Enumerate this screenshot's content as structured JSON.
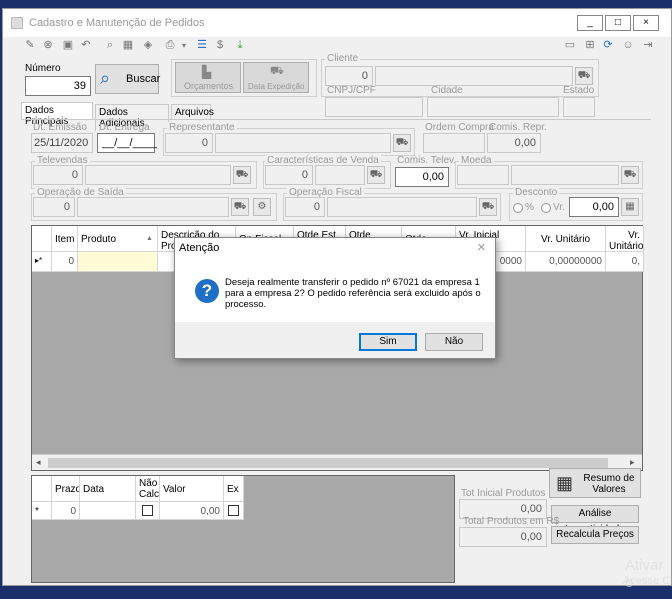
{
  "window": {
    "title": "Cadastro e Manutenção de Pedidos",
    "min": "_",
    "max": "□",
    "close": "×"
  },
  "numero": {
    "label": "Número",
    "value": "39",
    "buscar": "Buscar"
  },
  "tools": {
    "orcamentos": "Orçamentos",
    "data_expedicao": "Data Expedição"
  },
  "cliente": {
    "label": "Cliente",
    "code": "0",
    "cnpj_label": "CNPJ/CPF",
    "cidade_label": "Cidade",
    "estado_label": "Estado"
  },
  "tabs": [
    "Dados Principais",
    "Dados Adicionais",
    "Arquivos"
  ],
  "dados": {
    "dt_emissao_label": "Dt. Emissão",
    "dt_emissao": "25/11/2020",
    "dt_entrega_label": "Dt. Entrega",
    "dt_entrega": "__/__/____",
    "representante_label": "Representante",
    "representante": "0",
    "ordem_compra_label": "Ordem Compra",
    "comis_repr_label": "Comis. Repr.",
    "comis_repr": "0,00",
    "televendas_label": "Televendas",
    "televendas": "0",
    "caracteristicas_label": "Características de Venda",
    "caracteristicas": "0",
    "comis_telev_label": "Comis. Telev.",
    "comis_telev": "0,00",
    "moeda_label": "Moeda",
    "operacao_saida_label": "Operação de Saída",
    "operacao_saida": "0",
    "operacao_fiscal_label": "Operação Fiscal",
    "operacao_fiscal": "0",
    "desconto_label": "Desconto",
    "desconto_pct": "%",
    "desconto_vr": "Vr.",
    "desconto": "0,00"
  },
  "grid": {
    "headers": [
      "Item",
      "Produto",
      "Descrição do Produto",
      "Op.Fiscal",
      "Qtde Est.",
      "Qtde Conv.",
      "Qtde",
      "Vr. Inicial Original",
      "Vr. Unitário",
      "Vr. Unitário Original"
    ],
    "row": {
      "marker": "▸*",
      "item": "0",
      "vr_inicial": "0000",
      "vr_unitario": "0,00000000",
      "vr_unit_orig": "0,"
    }
  },
  "parcelas": {
    "headers": [
      "Prazo",
      "Data",
      "Não Calc",
      "Valor",
      "Ex"
    ],
    "row": {
      "marker": "*",
      "prazo": "0",
      "valor": "0,00"
    }
  },
  "totais": {
    "resumo": "Resumo de Valores",
    "tot_inicial_label": "Tot Inicial Produtos",
    "tot_inicial": "0,00",
    "analise": "Análise Lucratividade",
    "total_label": "Total Produtos em R$",
    "total": "0,00",
    "recalcula": "Recalcula Preços"
  },
  "dialog": {
    "title": "Atenção",
    "message": "Deseja realmente transferir o pedido nº 67021 da empresa 1 para a empresa 2? O pedido referência será excluido após o processo.",
    "yes": "Sim",
    "no": "Não",
    "close": "×",
    "icon": "?"
  },
  "watermark": {
    "line1": "Ativar o",
    "line2": "Acesse C"
  },
  "colors": {
    "accent": "#0078d7",
    "grid_bg": "#a9a9a9",
    "taskbar": "#1b2f6b"
  }
}
